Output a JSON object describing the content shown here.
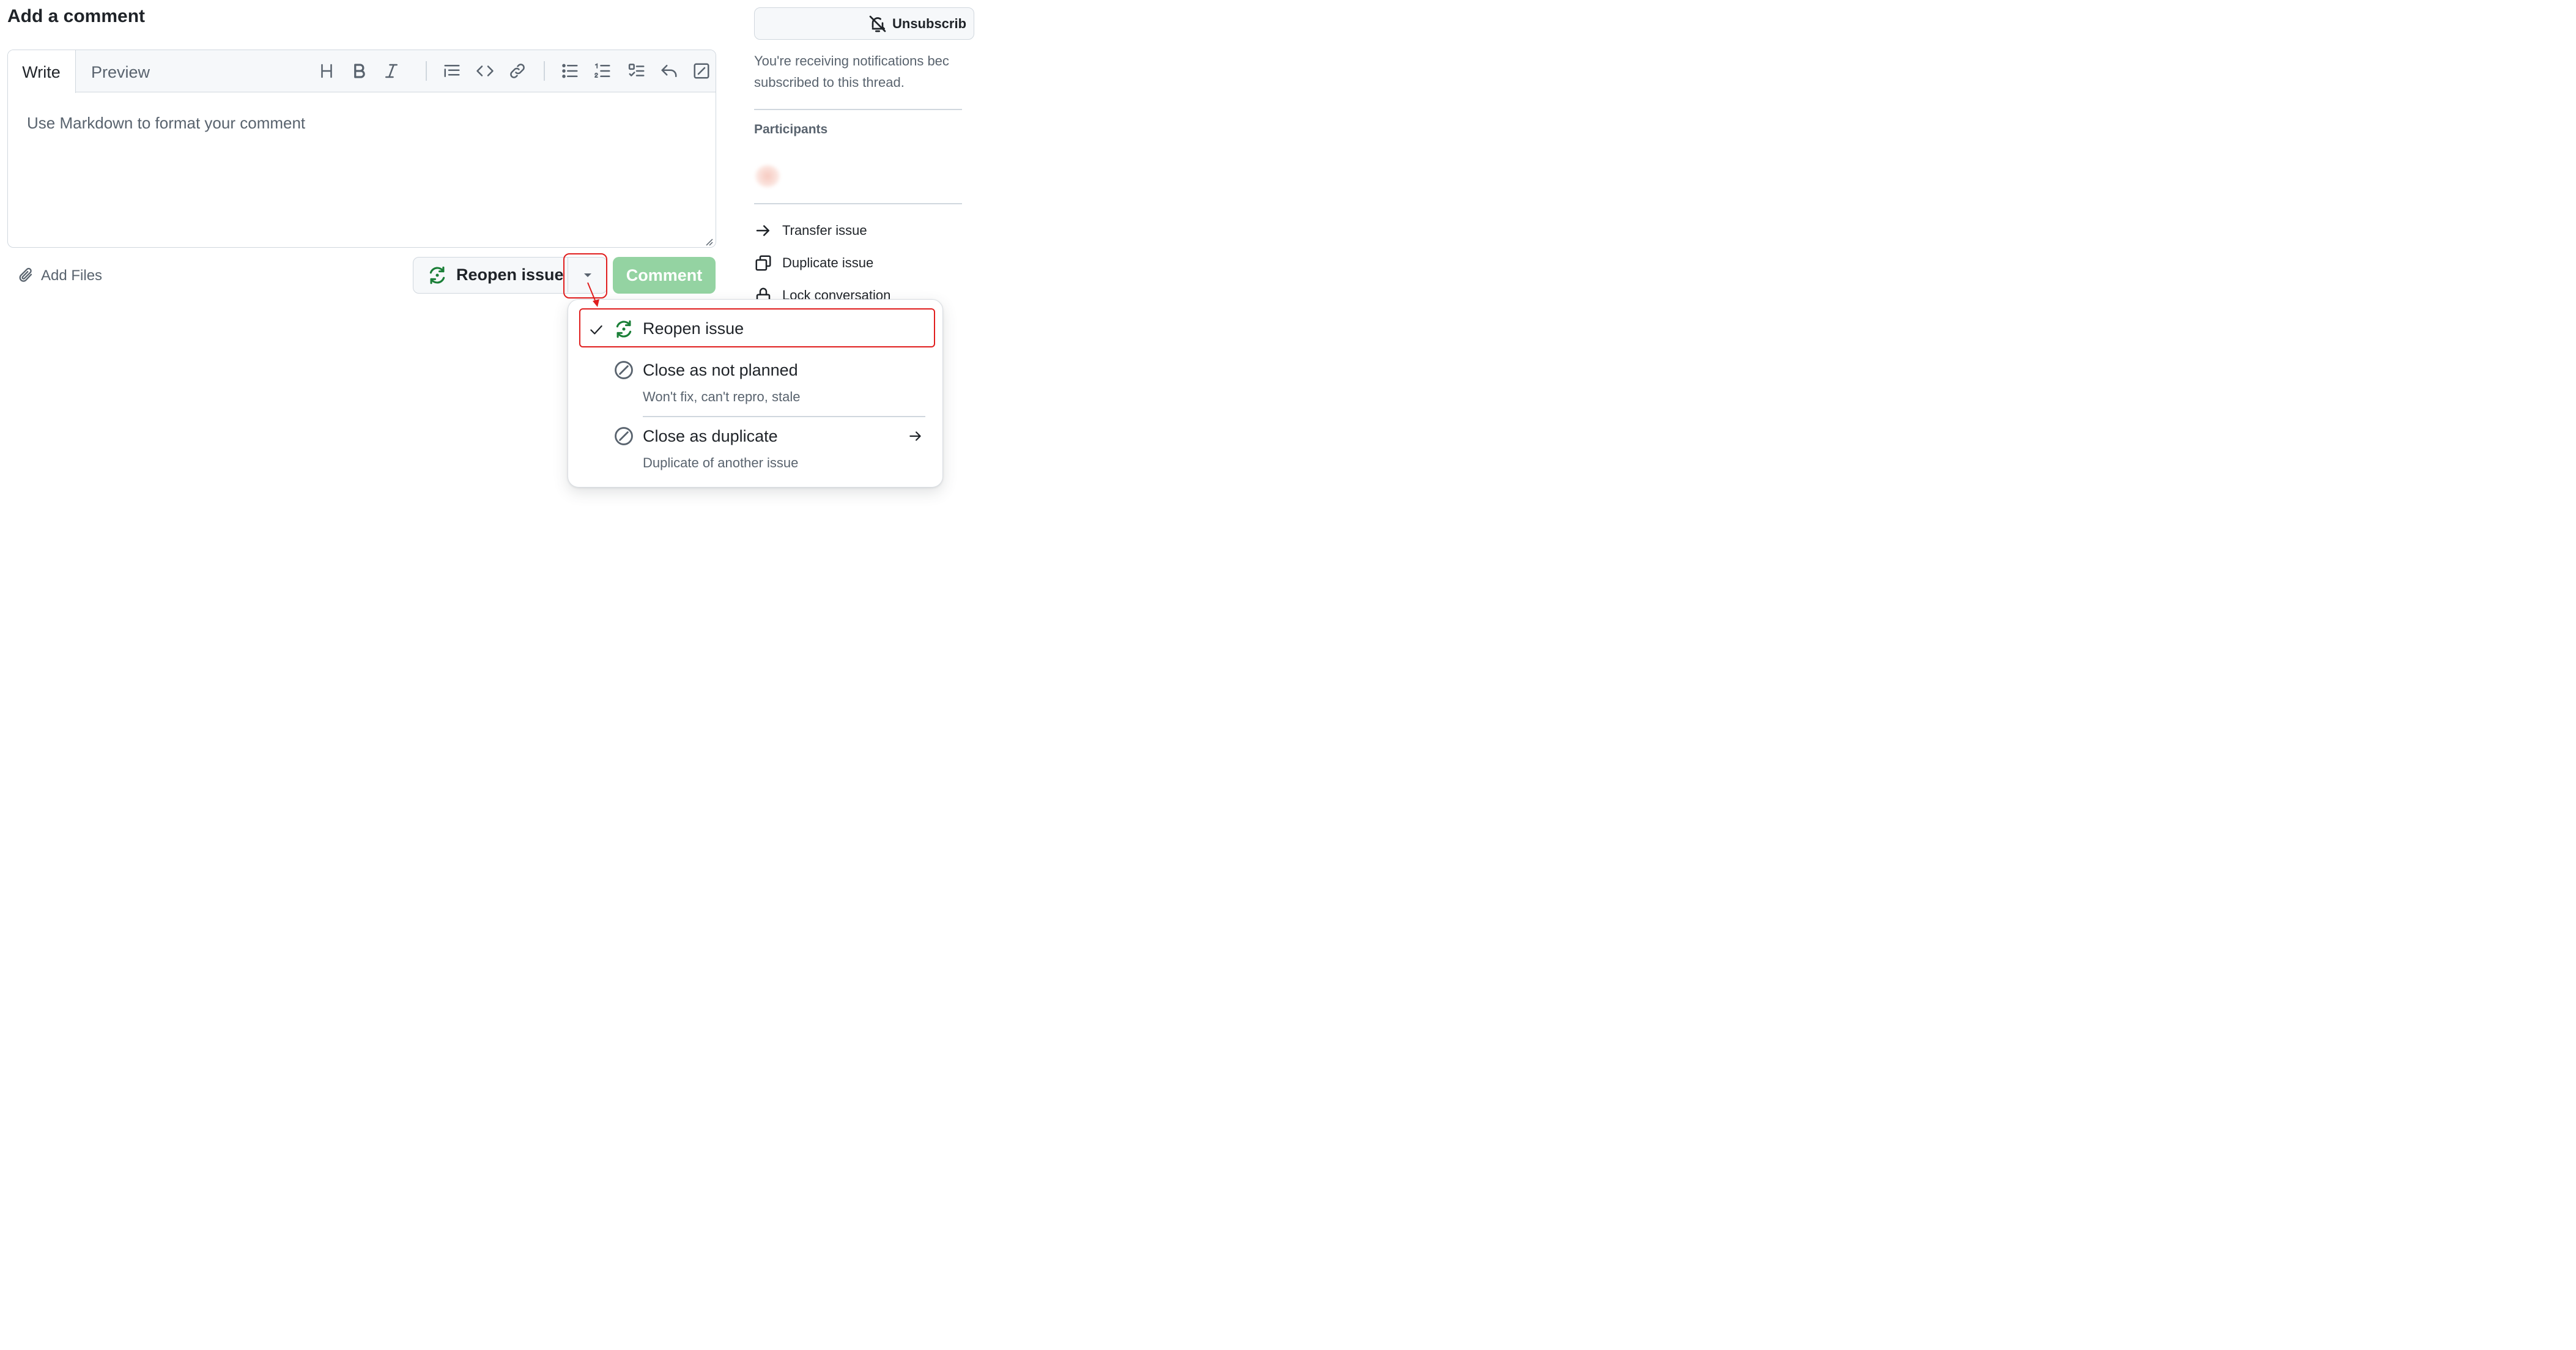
{
  "heading": "Add a comment",
  "editor": {
    "tabs": [
      {
        "label": "Write",
        "active": true
      },
      {
        "label": "Preview",
        "active": false
      }
    ],
    "toolbar_icons": [
      "heading-icon",
      "bold-icon",
      "italic-icon",
      "quote-icon",
      "code-icon",
      "link-icon",
      "unordered-list-icon",
      "ordered-list-icon",
      "task-list-icon",
      "reply-icon",
      "slash-command-icon"
    ],
    "placeholder": "Use Markdown to format your comment",
    "value": ""
  },
  "add_files_label": "Add Files",
  "reopen_button": {
    "label": "Reopen issue",
    "icon": "issue-reopened-icon"
  },
  "comment_button": {
    "label": "Comment",
    "disabled": true
  },
  "sidebar": {
    "unsubscribe_label": "Unsubscrib",
    "notification_text": {
      "line1": "You're receiving notifications bec",
      "line2": "subscribed to this thread."
    },
    "participants_heading": "Participants",
    "links": [
      {
        "label": "Transfer issue",
        "icon": "arrow-right-icon"
      },
      {
        "label": "Duplicate issue",
        "icon": "duplicate-icon"
      },
      {
        "label": "Lock conversation",
        "icon": "lock-icon"
      }
    ]
  },
  "menu": {
    "items": [
      {
        "title": "Reopen issue",
        "description": "",
        "selected": true,
        "icon": "issue-reopened-icon"
      },
      {
        "title": "Close as not planned",
        "description": "Won't fix, can't repro, stale",
        "selected": false,
        "icon": "skip-icon"
      },
      {
        "title": "Close as duplicate",
        "description": "Duplicate of another issue",
        "selected": false,
        "icon": "skip-icon",
        "has_submenu": true
      }
    ]
  },
  "colors": {
    "accent_green": "#1a7f37",
    "comment_button_disabled": "#94d3a2",
    "highlight_red": "#e01e1e",
    "text_primary": "#1f2328",
    "text_muted": "#59636e",
    "border": "#d0d7de"
  }
}
